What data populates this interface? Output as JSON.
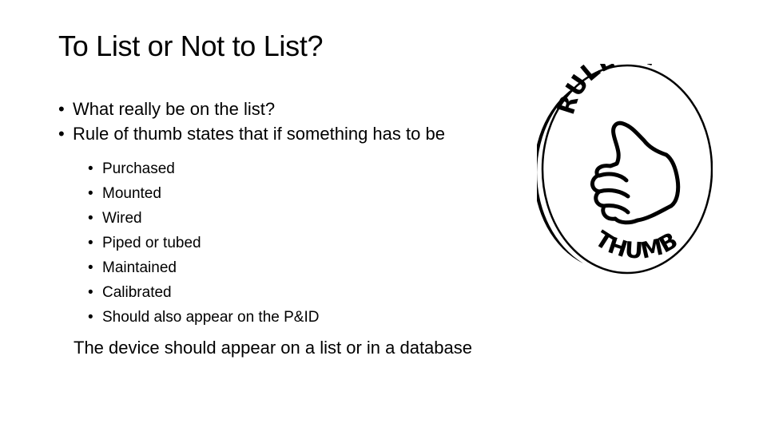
{
  "slide": {
    "title": "To List or Not to List?",
    "bullets": [
      "What really be on the list?",
      "Rule of thumb states that if something has to be"
    ],
    "sub_bullets": [
      "Purchased",
      "Mounted",
      "Wired",
      "Piped or tubed",
      "Maintained",
      "Calibrated",
      "Should also appear on the P&ID"
    ],
    "note": "The device should appear on a list or in a database"
  },
  "logo": {
    "top_text": "RULE OF",
    "bottom_text": "THUMB",
    "icon": "thumbs-up-icon"
  }
}
